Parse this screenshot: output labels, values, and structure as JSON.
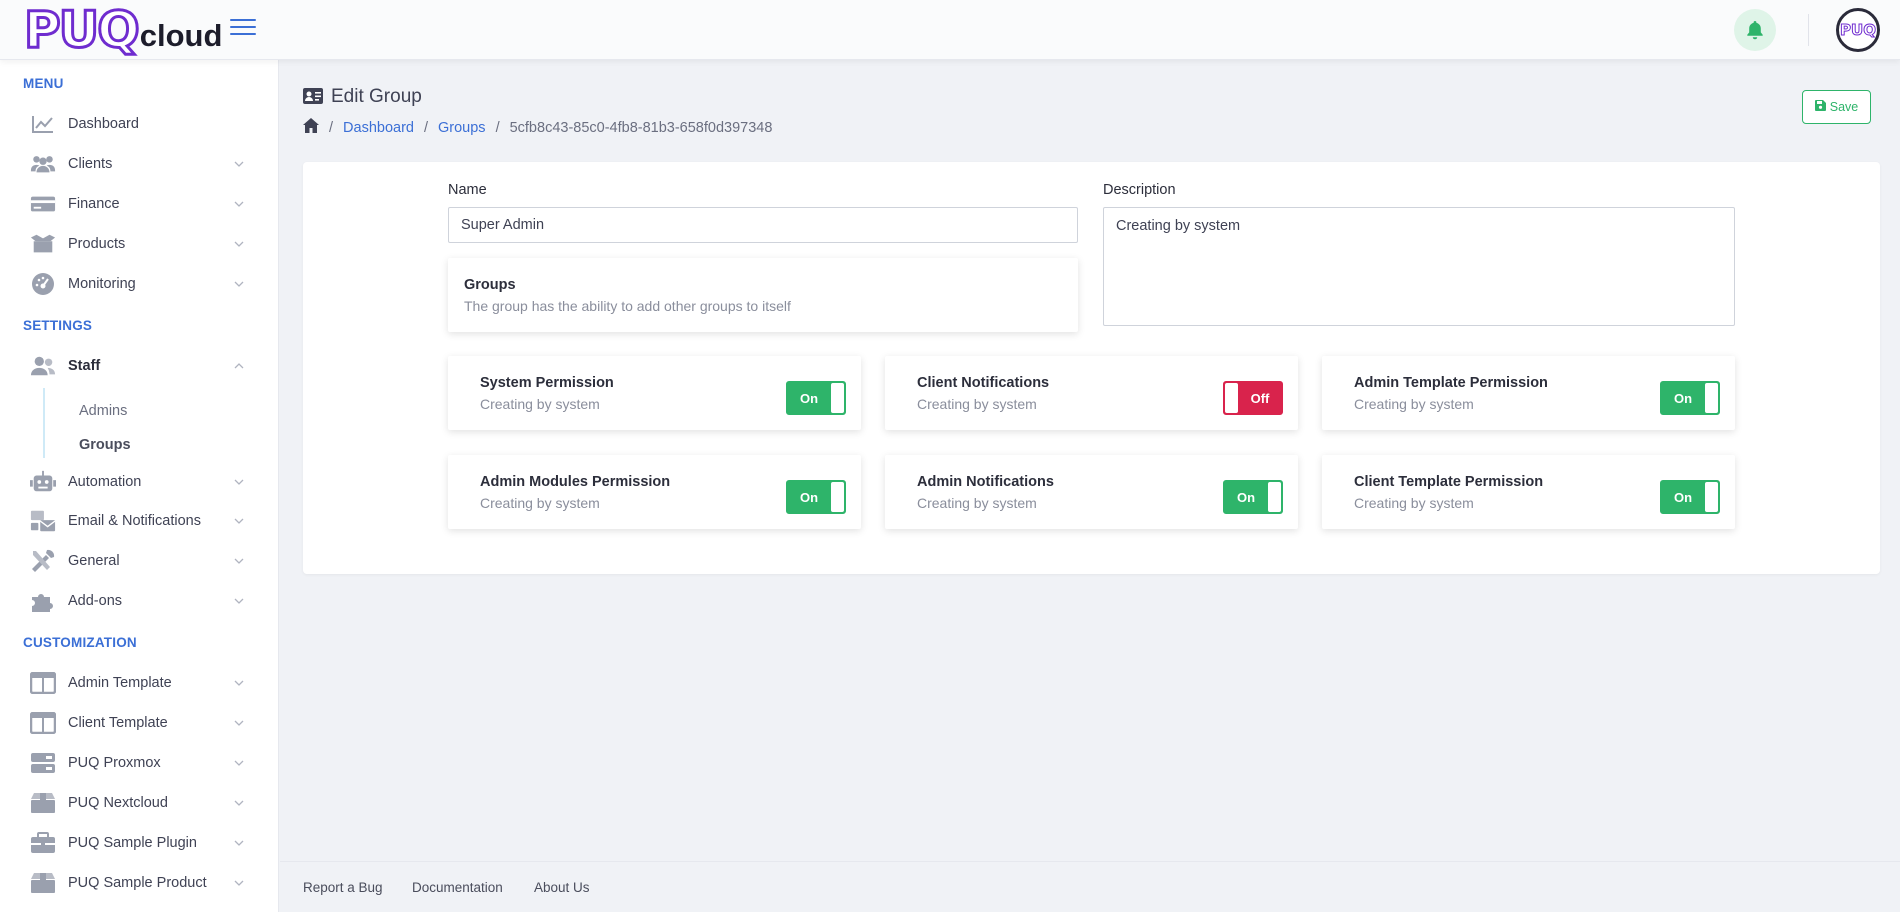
{
  "brand": {
    "logo_main": "PUQ",
    "logo_sub": "cloud",
    "avatar_text": "PUQ"
  },
  "sidebar": {
    "menu_label": "MENU",
    "settings_label": "SETTINGS",
    "customization_label": "CUSTOMIZATION",
    "menu_items": [
      {
        "label": "Dashboard",
        "icon": "chart-line-icon"
      },
      {
        "label": "Clients",
        "icon": "users-icon"
      },
      {
        "label": "Finance",
        "icon": "credit-card-icon"
      },
      {
        "label": "Products",
        "icon": "box-open-icon"
      },
      {
        "label": "Monitoring",
        "icon": "gauge-icon"
      }
    ],
    "settings_items": [
      {
        "label": "Staff",
        "icon": "user-group-icon"
      },
      {
        "label": "Automation",
        "icon": "robot-icon"
      },
      {
        "label": "Email & Notifications",
        "icon": "mail-bulk-icon"
      },
      {
        "label": "General",
        "icon": "tools-icon"
      },
      {
        "label": "Add-ons",
        "icon": "puzzle-icon"
      }
    ],
    "staff_sub": [
      {
        "label": "Admins"
      },
      {
        "label": "Groups"
      }
    ],
    "customization_items": [
      {
        "label": "Admin Template",
        "icon": "layout-icon"
      },
      {
        "label": "Client Template",
        "icon": "layout-icon"
      },
      {
        "label": "PUQ Proxmox",
        "icon": "server-icon"
      },
      {
        "label": "PUQ Nextcloud",
        "icon": "box-icon"
      },
      {
        "label": "PUQ Sample Plugin",
        "icon": "briefcase-icon"
      },
      {
        "label": "PUQ Sample Product",
        "icon": "box-icon"
      }
    ]
  },
  "page": {
    "title": "Edit Group",
    "breadcrumb": {
      "dashboard": "Dashboard",
      "groups": "Groups",
      "current": "5cfb8c43-85c0-4fb8-81b3-658f0d397348"
    },
    "save_label": "Save"
  },
  "form": {
    "name_label": "Name",
    "name_value": "Super Admin",
    "description_label": "Description",
    "description_value": "Creating by system",
    "groups_title": "Groups",
    "groups_desc": "The group has the ability to add other groups to itself"
  },
  "permissions": [
    {
      "title": "System Permission",
      "desc": "Creating by system",
      "state": "On"
    },
    {
      "title": "Client Notifications",
      "desc": "Creating by system",
      "state": "Off"
    },
    {
      "title": "Admin Template Permission",
      "desc": "Creating by system",
      "state": "On"
    },
    {
      "title": "Admin Modules Permission",
      "desc": "Creating by system",
      "state": "On"
    },
    {
      "title": "Admin Notifications",
      "desc": "Creating by system",
      "state": "On"
    },
    {
      "title": "Client Template Permission",
      "desc": "Creating by system",
      "state": "On"
    }
  ],
  "footer": {
    "bug": "Report a Bug",
    "docs": "Documentation",
    "about": "About Us"
  },
  "colors": {
    "accent": "#3b6fd6",
    "success": "#2eb46a",
    "danger": "#d9234c",
    "brand": "#6f2ccf"
  }
}
